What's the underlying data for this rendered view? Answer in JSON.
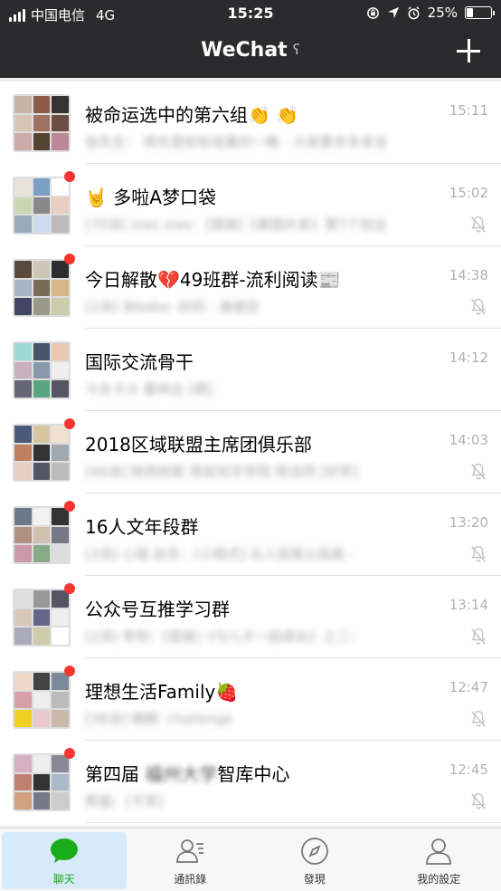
{
  "status": {
    "carrier": "中国电信",
    "network": "4G",
    "time": "15:25",
    "battery": "25%",
    "battery_level": 0.25
  },
  "nav": {
    "title": "WeChat"
  },
  "chats": [
    {
      "title": "被命运选中的第六组👏 👏",
      "time": "15:11",
      "preview": "张先生：  明天是轮轮成果的一晚 - 大家要多多发言",
      "unread": false,
      "muted": false
    },
    {
      "title": "🤘 多啦A梦口袋",
      "time": "15:02",
      "preview": "[70消] xiao xiao：[链接]《美国外卖》第7个创业",
      "unread": true,
      "muted": true
    },
    {
      "title": "今日解散💔49班群-流利阅读📰",
      "time": "14:38",
      "preview": "[2消] 米babe: 好的 - 谢谢您",
      "unread": true,
      "muted": true
    },
    {
      "title": "国际交流骨干",
      "time": "14:12",
      "preview": "卡夫卡大 翟林志 [晒]",
      "unread": false,
      "muted": false
    },
    {
      "title": "2018区域联盟主席团俱乐部",
      "time": "14:03",
      "preview": "[46消] 陕西校联 西安培华学院 杨浩然 [好笑]",
      "unread": true,
      "muted": true
    },
    {
      "title": "16人文年段群",
      "time": "13:20",
      "preview": "[3消] 心瑶 赵东：[小程式] 众人拾柴火焰高 -",
      "unread": true,
      "muted": true
    },
    {
      "title": "公众号互推学习群",
      "time": "13:14",
      "preview": "[2消] 李阳：[链接]《与儿子一起成长》之二：",
      "unread": true,
      "muted": true
    },
    {
      "title": "理想生活Family🍓",
      "time": "12:47",
      "preview": "[38消] 晴朗: challenge",
      "unread": true,
      "muted": true
    },
    {
      "title": "第四届 福州大学智库中心",
      "time": "12:45",
      "preview": "熊猫：[不笑]",
      "unread": true,
      "muted": true
    }
  ],
  "tabs": [
    {
      "label": "聊天",
      "icon": "chat-bubble-icon",
      "active": true
    },
    {
      "label": "通訊錄",
      "icon": "contacts-icon",
      "active": false
    },
    {
      "label": "發現",
      "icon": "compass-icon",
      "active": false
    },
    {
      "label": "我的設定",
      "icon": "person-icon",
      "active": false
    }
  ],
  "colors": {
    "bar": "#2b2b2d",
    "badge": "#f43530",
    "accent": "#1aad19",
    "active_tab_bg": "#d6eafa"
  }
}
